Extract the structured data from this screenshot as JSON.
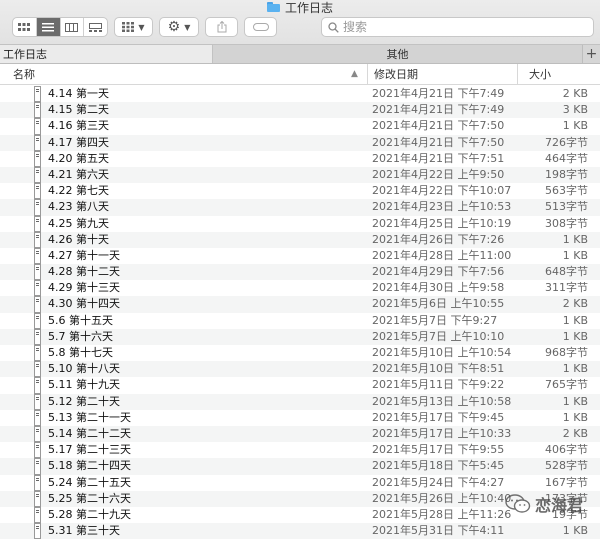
{
  "window": {
    "title": "工作日志"
  },
  "toolbar": {
    "view_modes": [
      "icon",
      "list",
      "column",
      "gallery"
    ],
    "active_view": 1,
    "group_icon": "grid-icon",
    "action_icon": "gear-icon",
    "share_icon": "share-icon",
    "tag_icon": "tag-icon"
  },
  "search": {
    "placeholder": "搜索"
  },
  "tabs": {
    "active_label": "工作日志",
    "other_label": "其他",
    "add_label": "+"
  },
  "columns": {
    "name": "名称",
    "date": "修改日期",
    "size": "大小"
  },
  "files": [
    {
      "name": "4.14 第一天",
      "date": "2021年4月21日 下午7:49",
      "size": "2 KB"
    },
    {
      "name": "4.15 第二天",
      "date": "2021年4月21日 下午7:49",
      "size": "3 KB"
    },
    {
      "name": "4.16 第三天",
      "date": "2021年4月21日 下午7:50",
      "size": "1 KB"
    },
    {
      "name": "4.17 第四天",
      "date": "2021年4月21日 下午7:50",
      "size": "726字节"
    },
    {
      "name": "4.20 第五天",
      "date": "2021年4月21日 下午7:51",
      "size": "464字节"
    },
    {
      "name": "4.21 第六天",
      "date": "2021年4月22日 上午9:50",
      "size": "198字节"
    },
    {
      "name": "4.22 第七天",
      "date": "2021年4月22日 下午10:07",
      "size": "563字节"
    },
    {
      "name": "4.23 第八天",
      "date": "2021年4月23日 上午10:53",
      "size": "513字节"
    },
    {
      "name": "4.25 第九天",
      "date": "2021年4月25日 上午10:19",
      "size": "308字节"
    },
    {
      "name": "4.26 第十天",
      "date": "2021年4月26日 下午7:26",
      "size": "1 KB"
    },
    {
      "name": "4.27 第十一天",
      "date": "2021年4月28日 上午11:00",
      "size": "1 KB"
    },
    {
      "name": "4.28 第十二天",
      "date": "2021年4月29日 下午7:56",
      "size": "648字节"
    },
    {
      "name": "4.29 第十三天",
      "date": "2021年4月30日 上午9:58",
      "size": "311字节"
    },
    {
      "name": "4.30 第十四天",
      "date": "2021年5月6日 上午10:55",
      "size": "2 KB"
    },
    {
      "name": "5.6 第十五天",
      "date": "2021年5月7日 下午9:27",
      "size": "1 KB"
    },
    {
      "name": "5.7 第十六天",
      "date": "2021年5月7日 上午10:10",
      "size": "1 KB"
    },
    {
      "name": "5.8 第十七天",
      "date": "2021年5月10日 上午10:54",
      "size": "968字节"
    },
    {
      "name": "5.10 第十八天",
      "date": "2021年5月10日 下午8:51",
      "size": "1 KB"
    },
    {
      "name": "5.11 第十九天",
      "date": "2021年5月11日 下午9:22",
      "size": "765字节"
    },
    {
      "name": "5.12 第二十天",
      "date": "2021年5月13日 上午10:58",
      "size": "1 KB"
    },
    {
      "name": "5.13 第二十一天",
      "date": "2021年5月17日 下午9:45",
      "size": "1 KB"
    },
    {
      "name": "5.14 第二十二天",
      "date": "2021年5月17日 上午10:33",
      "size": "2 KB"
    },
    {
      "name": "5.17 第二十三天",
      "date": "2021年5月17日 下午9:55",
      "size": "406字节"
    },
    {
      "name": "5.18 第二十四天",
      "date": "2021年5月18日 下午5:45",
      "size": "528字节"
    },
    {
      "name": "5.24 第二十五天",
      "date": "2021年5月24日 下午4:27",
      "size": "167字节"
    },
    {
      "name": "5.25 第二十六天",
      "date": "2021年5月26日 上午10:40",
      "size": "173字节"
    },
    {
      "name": "5.28 第二十九天",
      "date": "2021年5月28日 上午11:26",
      "size": "19字节"
    },
    {
      "name": "5.31 第三十天",
      "date": "2021年5月31日 下午4:11",
      "size": "1 KB"
    }
  ],
  "watermark": {
    "text": "恋海君",
    "icon": "wechat-icon"
  }
}
